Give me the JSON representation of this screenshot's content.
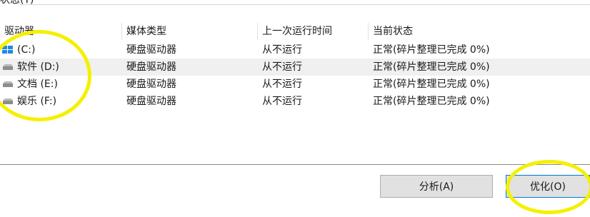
{
  "section": {
    "title": "状态(T)"
  },
  "columns": [
    "驱动器",
    "媒体类型",
    "上一次运行时间",
    "当前状态"
  ],
  "drives": [
    {
      "name": "(C:)",
      "media": "硬盘驱动器",
      "last_run": "从不运行",
      "status": "正常(碎片整理已完成 0%)",
      "icon": "windows-drive-icon"
    },
    {
      "name": "软件 (D:)",
      "media": "硬盘驱动器",
      "last_run": "从不运行",
      "status": "正常(碎片整理已完成 0%)",
      "icon": "drive-icon"
    },
    {
      "name": "文档 (E:)",
      "media": "硬盘驱动器",
      "last_run": "从不运行",
      "status": "正常(碎片整理已完成 0%)",
      "icon": "drive-icon"
    },
    {
      "name": "娱乐 (F:)",
      "media": "硬盘驱动器",
      "last_run": "从不运行",
      "status": "正常(碎片整理已完成 0%)",
      "icon": "drive-icon"
    }
  ],
  "buttons": {
    "analyze": "分析(A)",
    "optimize": "优化(O)"
  },
  "colors": {
    "highlight": "#f5f000",
    "row_selected": "#f0f0f0",
    "accent": "#0078d7"
  }
}
